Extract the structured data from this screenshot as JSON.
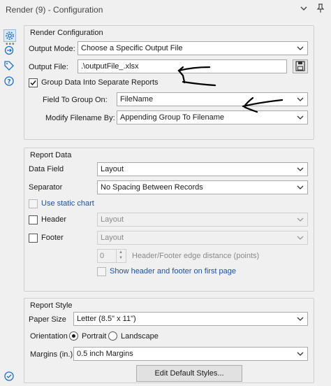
{
  "window": {
    "title": "Render (9) - Configuration"
  },
  "render_config": {
    "section_title": "Render Configuration",
    "output_mode_label": "Output Mode:",
    "output_mode_value": "Choose a Specific Output File",
    "output_file_label": "Output File:",
    "output_file_value": ".\\outputFile_.xlsx",
    "group_data_label": "Group Data Into Separate Reports",
    "group_data_checked": true,
    "field_to_group_label": "Field To Group On:",
    "field_to_group_value": "FileName",
    "modify_filename_label": "Modify Filename By:",
    "modify_filename_value": "Appending Group To Filename"
  },
  "report_data": {
    "section_title": "Report Data",
    "data_field_label": "Data Field",
    "data_field_value": "Layout",
    "separator_label": "Separator",
    "separator_value": "No Spacing Between Records",
    "use_static_chart_label": "Use static chart",
    "header_label": "Header",
    "header_value": "Layout",
    "footer_label": "Footer",
    "footer_value": "Layout",
    "edge_distance_value": "0",
    "edge_distance_label": "Header/Footer edge distance (points)",
    "show_header_footer_label": "Show header and footer on first page"
  },
  "report_style": {
    "section_title": "Report Style",
    "paper_size_label": "Paper Size",
    "paper_size_value": "Letter (8.5\" x 11\")",
    "orientation_label": "Orientation",
    "portrait_label": "Portrait",
    "landscape_label": "Landscape",
    "orientation_selected": "Portrait",
    "margins_label": "Margins (in.)",
    "margins_value": "0.5 inch Margins",
    "edit_styles_label": "Edit Default Styles..."
  },
  "colors": {
    "background": "#f0f0f0",
    "border": "#a9a9a9",
    "accent_icon": "#1f6fc4",
    "link_text": "#1f4fa0",
    "annotation_ink": "#000000"
  },
  "icons": [
    "chevron-down-icon",
    "pin-icon",
    "gear-icon",
    "connection-icon",
    "tag-icon",
    "help-icon",
    "save-icon",
    "check-circle-icon"
  ]
}
